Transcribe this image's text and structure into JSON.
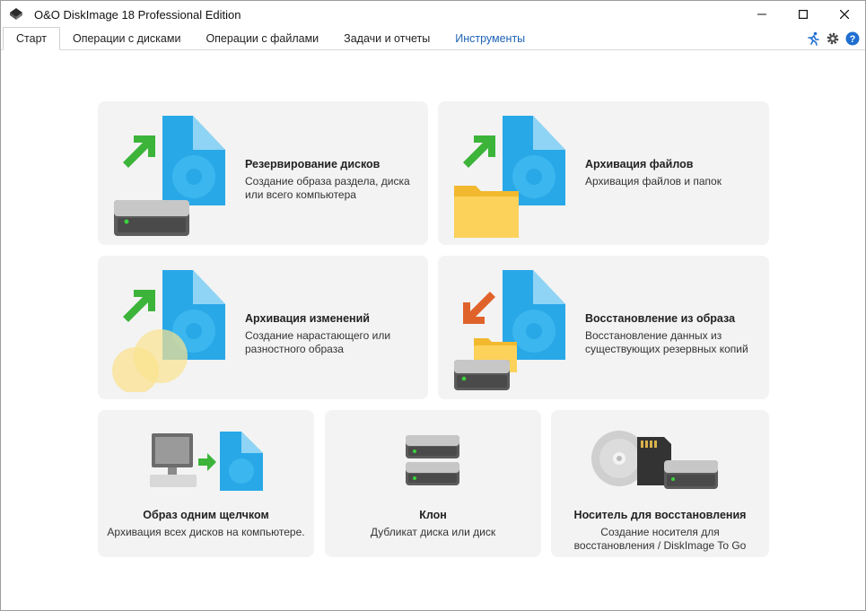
{
  "window": {
    "title": "O&O DiskImage 18 Professional Edition",
    "controls": [
      "minimize-icon",
      "maximize-icon",
      "close-icon"
    ]
  },
  "tabs": [
    {
      "label": "Старт"
    },
    {
      "label": "Операции с дисками"
    },
    {
      "label": "Операции с файлами"
    },
    {
      "label": "Задачи и отчеты"
    },
    {
      "label": "Инструменты"
    }
  ],
  "toolbar_icons": [
    "runner-icon",
    "gear-icon",
    "help-icon"
  ],
  "colors": {
    "accent": "#1e63b5",
    "tile_bg": "#f3f3f3",
    "help_blue": "#1f6fd1",
    "arrow_green": "#3cb43a",
    "arrow_orange": "#e0622b",
    "doc_blue": "#29a8e8"
  },
  "tiles": [
    {
      "title": "Резервирование дисков",
      "desc": "Создание образа раздела, диска или всего компьютера"
    },
    {
      "title": "Архивация файлов",
      "desc": "Архивация файлов и папок"
    },
    {
      "title": "Архивация изменений",
      "desc": "Создание нарастающего или разностного образа"
    },
    {
      "title": "Восстановление из образа",
      "desc": "Восстановление данных из существующих резервных копий"
    },
    {
      "title": "Образ одним щелчком",
      "desc": "Архивация всех дисков на компьютере."
    },
    {
      "title": "Клон",
      "desc": "Дубликат диска или диск"
    },
    {
      "title": "Носитель для восстановления",
      "desc": "Создание носителя для восстановления / DiskImage To Go"
    }
  ]
}
